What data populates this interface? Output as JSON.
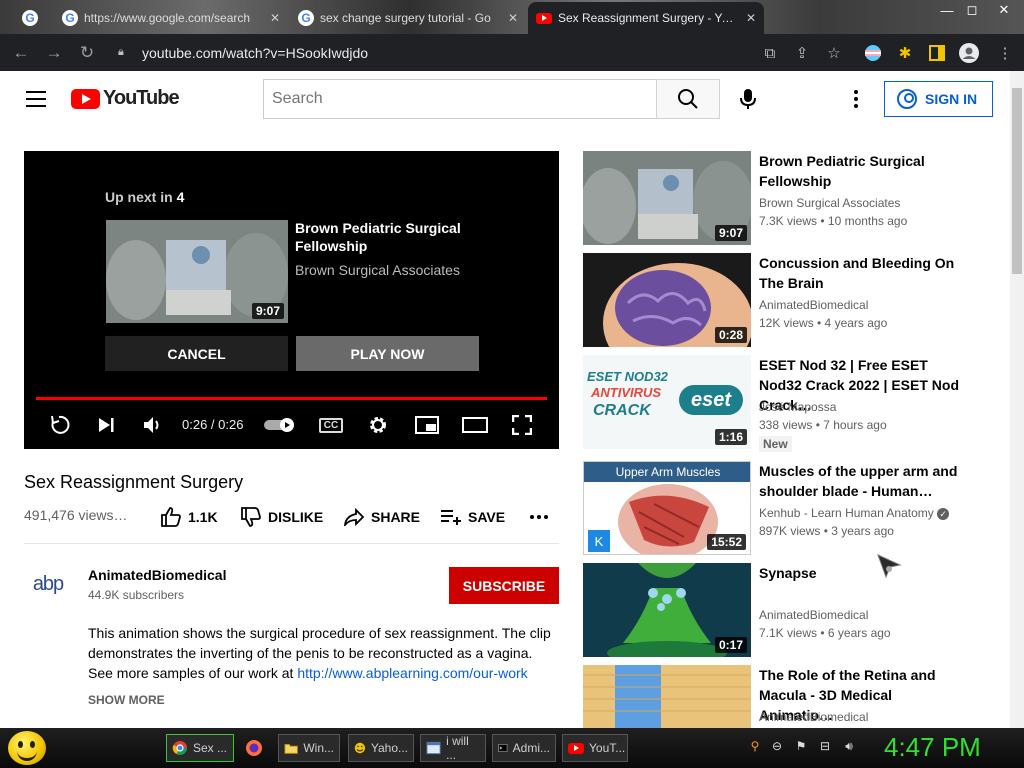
{
  "browser": {
    "tabs": [
      {
        "label": "https://www.google.com/search",
        "icon": "google-icon",
        "active": false
      },
      {
        "label": "sex change surgery tutorial - Go",
        "icon": "google-icon",
        "active": false
      },
      {
        "label": "Sex Reassignment Surgery - YouT",
        "icon": "youtube-icon",
        "active": true
      }
    ],
    "url": "youtube.com/watch?v=HSookIwdjdo",
    "window_controls": [
      "—",
      "◻",
      "✕"
    ]
  },
  "youtube": {
    "logo_text": "YouTube",
    "search_placeholder": "Search",
    "sign_in_label": "SIGN IN",
    "player": {
      "up_next_label": "Up next in",
      "up_next_count": "4",
      "next_title": "Brown Pediatric Surgical Fellowship",
      "next_channel": "Brown Surgical Associates",
      "next_duration": "9:07",
      "cancel_label": "CANCEL",
      "play_now_label": "PLAY NOW",
      "time": "0:26 / 0:26",
      "progress_fraction": 1.0,
      "cc_label": "CC"
    },
    "video": {
      "title": "Sex Reassignment Surgery",
      "views": "491,476 views…",
      "like_count": "1.1K",
      "dislike_label": "DISLIKE",
      "share_label": "SHARE",
      "save_label": "SAVE"
    },
    "channel": {
      "avatar_text": "abp",
      "name": "AnimatedBiomedical",
      "subscribers": "44.9K subscribers",
      "subscribe_label": "SUBSCRIBE"
    },
    "description": {
      "text": "This animation shows the surgical procedure of sex reassignment. The clip demonstrates the inverting of the penis to be reconstructed as a vagina. See more samples of our work at ",
      "link": "http://www.abplearning.com/our-work",
      "show_more": "SHOW MORE"
    },
    "recommendations": [
      {
        "title": "Brown Pediatric Surgical Fellowship",
        "channel": "Brown Surgical Associates",
        "meta": "7.3K views • 10 months ago",
        "duration": "9:07",
        "verified": false,
        "badge": ""
      },
      {
        "title": "Concussion and Bleeding On The Brain",
        "channel": "AnimatedBiomedical",
        "meta": "12K views • 4 years ago",
        "duration": "0:28",
        "verified": false,
        "badge": ""
      },
      {
        "title": "ESET Nod 32 | Free ESET Nod32 Crack 2022 | ESET Nod Crack…",
        "channel": "José Mapossa",
        "meta": "338 views • 7 hours ago",
        "duration": "1:16",
        "verified": false,
        "badge": "New",
        "thumb_text_1": "ESET NOD32",
        "thumb_text_2": "ANTIVIRUS",
        "thumb_text_3": "CRACK",
        "thumb_text_4": "eset"
      },
      {
        "title": "Muscles of the upper arm and shoulder blade - Human…",
        "channel": "Kenhub - Learn Human Anatomy",
        "meta": "897K views • 3 years ago",
        "duration": "15:52",
        "verified": true,
        "badge": "",
        "thumb_text_1": "Upper Arm Muscles",
        "thumb_text_2": "K"
      },
      {
        "title": "Synapse",
        "channel": "AnimatedBiomedical",
        "meta": "7.1K views • 6 years ago",
        "duration": "0:17",
        "verified": false,
        "badge": ""
      },
      {
        "title": "The Role of the Retina and Macula - 3D Medical Animatio…",
        "channel": "AnimatedBiomedical",
        "meta": "",
        "duration": "",
        "verified": false,
        "badge": ""
      }
    ]
  },
  "taskbar": {
    "tasks": [
      {
        "label": "Sex ...",
        "icon": "chrome-icon"
      },
      {
        "label": "",
        "icon": "firefox-icon"
      },
      {
        "label": "Win...",
        "icon": "folder-icon"
      },
      {
        "label": "Yaho...",
        "icon": "messenger-icon"
      },
      {
        "label": "i will ...",
        "icon": "window-icon"
      },
      {
        "label": "Admi...",
        "icon": "cmd-icon"
      },
      {
        "label": "YouT...",
        "icon": "youtube-icon"
      }
    ],
    "clock": "4:47 PM"
  }
}
